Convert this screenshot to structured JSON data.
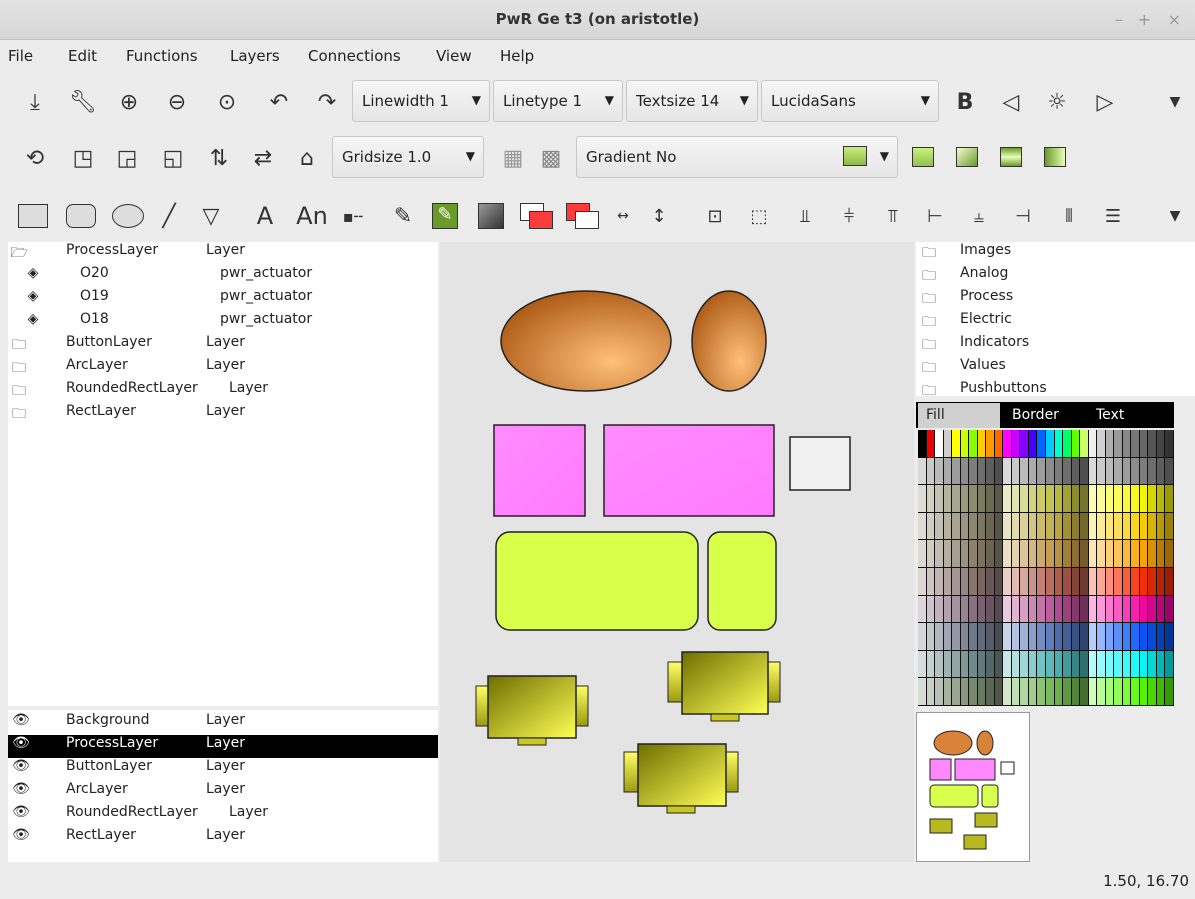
{
  "window": {
    "title": "PwR Ge   t3 (on aristotle)",
    "controls": [
      "–",
      "+",
      "×"
    ]
  },
  "menu": [
    "File",
    "Edit",
    "Functions",
    "Layers",
    "Connections",
    "View",
    "Help"
  ],
  "toolbar1": {
    "linewidth": "Linewidth 1",
    "linetype": "Linetype 1",
    "textsize": "Textsize 14",
    "font": "LucidaSans",
    "bold": "B"
  },
  "toolbar2": {
    "gridsize": "Gridsize 1.0",
    "gradient": "Gradient No"
  },
  "toolbar3": {
    "text_tool": "A",
    "annot_tool": "An"
  },
  "layer_tree": [
    {
      "icon": "open-folder",
      "name": "ProcessLayer",
      "type": "Layer",
      "indent": 0
    },
    {
      "icon": "eye-small",
      "name": "O20",
      "type": "pwr_actuator",
      "indent": 1
    },
    {
      "icon": "eye-small",
      "name": "O19",
      "type": "pwr_actuator",
      "indent": 1
    },
    {
      "icon": "eye-small",
      "name": "O18",
      "type": "pwr_actuator",
      "indent": 1
    },
    {
      "icon": "folder",
      "name": "ButtonLayer",
      "type": "Layer",
      "indent": 0
    },
    {
      "icon": "folder",
      "name": "ArcLayer",
      "type": "Layer",
      "indent": 0
    },
    {
      "icon": "folder",
      "name": "RoundedRectLayer",
      "type": "Layer",
      "indent": 0
    },
    {
      "icon": "folder",
      "name": "RectLayer",
      "type": "Layer",
      "indent": 0
    }
  ],
  "layer_list": [
    {
      "name": "Background",
      "type": "Layer",
      "selected": false
    },
    {
      "name": "ProcessLayer",
      "type": "Layer",
      "selected": true
    },
    {
      "name": "ButtonLayer",
      "type": "Layer",
      "selected": false
    },
    {
      "name": "ArcLayer",
      "type": "Layer",
      "selected": false
    },
    {
      "name": "RoundedRectLayer",
      "type": "Layer",
      "selected": false
    },
    {
      "name": "RectLayer",
      "type": "Layer",
      "selected": false
    }
  ],
  "palette_folders": [
    "Images",
    "Analog",
    "Process",
    "Electric",
    "Indicators",
    "Values",
    "Pushbuttons"
  ],
  "color_tabs": [
    "Fill",
    "Border",
    "Text"
  ],
  "colors": {
    "orange": "#d9823a",
    "pink": "#ff88ff",
    "lime": "#d9ff4d",
    "selection": "#000000",
    "canvas": "#e4e4e4"
  },
  "status": {
    "coords": "1.50, 16.70"
  }
}
